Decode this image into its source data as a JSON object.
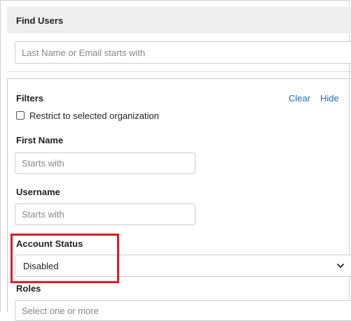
{
  "find_users": {
    "title": "Find Users",
    "search_placeholder": "Last Name or Email starts with"
  },
  "filters": {
    "title": "Filters",
    "clear_label": "Clear",
    "hide_label": "Hide",
    "restrict_label": "Restrict to selected organization",
    "restrict_checked": false,
    "first_name": {
      "label": "First Name",
      "placeholder": "Starts with"
    },
    "username": {
      "label": "Username",
      "placeholder": "Starts with"
    },
    "account_status": {
      "label": "Account Status",
      "selected": "Disabled"
    },
    "roles": {
      "label": "Roles",
      "placeholder": "Select one or more"
    }
  },
  "icons": {
    "dropdown": "chevron-down-icon"
  },
  "colors": {
    "link": "#1a6fc4",
    "highlight": "#e01b24",
    "header_bg": "#eeeeee"
  }
}
